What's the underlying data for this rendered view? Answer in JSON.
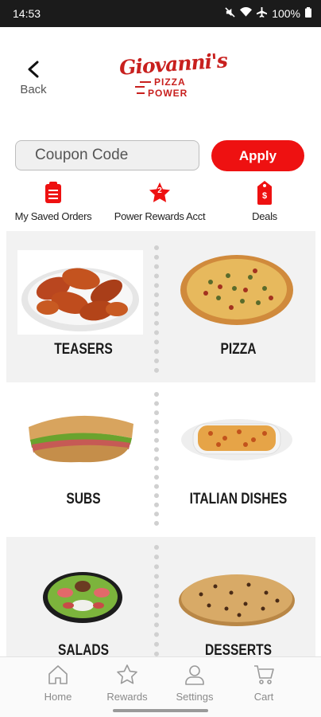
{
  "status_bar": {
    "time": "14:53",
    "battery": "100%"
  },
  "header": {
    "back_label": "Back",
    "logo": {
      "script": "Giovanni's",
      "line1": "PIZZA",
      "line2": "POWER"
    }
  },
  "coupon": {
    "placeholder": "Coupon Code",
    "value": "",
    "apply_label": "Apply"
  },
  "quick_links": [
    {
      "label": "My Saved Orders",
      "icon": "clipboard-icon"
    },
    {
      "label": "Power Rewards Acct",
      "icon": "star-badge-icon",
      "badge": "2"
    },
    {
      "label": "Deals",
      "icon": "price-tag-icon"
    }
  ],
  "menu_categories": [
    {
      "label": "TEASERS",
      "icon": "chicken-wings-image"
    },
    {
      "label": "PIZZA",
      "icon": "pizza-image"
    },
    {
      "label": "SUBS",
      "icon": "sub-sandwich-image"
    },
    {
      "label": "ITALIAN DISHES",
      "icon": "lasagna-image"
    },
    {
      "label": "SALADS",
      "icon": "salad-image"
    },
    {
      "label": "DESSERTS",
      "icon": "cookie-image"
    }
  ],
  "bottom_nav": [
    {
      "label": "Home",
      "icon": "home-icon"
    },
    {
      "label": "Rewards",
      "icon": "star-icon"
    },
    {
      "label": "Settings",
      "icon": "person-icon"
    },
    {
      "label": "Cart",
      "icon": "cart-icon"
    }
  ],
  "colors": {
    "brand_red": "#ee1111",
    "logo_red": "#c8201e",
    "tile_gray": "#f2f2f2"
  }
}
